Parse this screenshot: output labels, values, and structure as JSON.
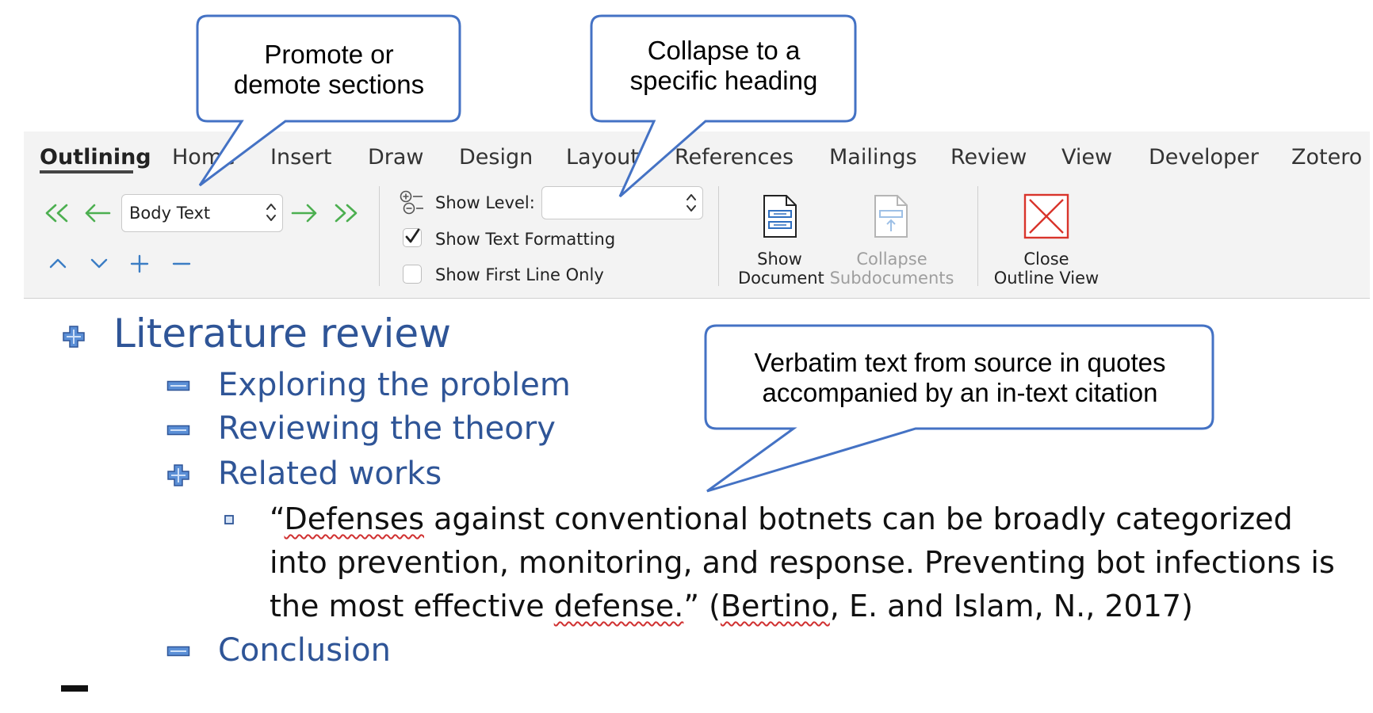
{
  "tabs": [
    "Outlining",
    "Home",
    "Insert",
    "Draw",
    "Design",
    "Layout",
    "References",
    "Mailings",
    "Review",
    "View",
    "Developer",
    "Zotero"
  ],
  "outline_tools": {
    "level_select": "Body Text",
    "show_level_label": "Show Level:",
    "show_level_value": "",
    "show_text_formatting": "Show Text Formatting",
    "show_first_line_only": "Show First Line Only",
    "show_document": [
      "Show",
      "Document"
    ],
    "collapse_subdocuments": [
      "Collapse",
      "Subdocuments"
    ],
    "close_outline_view": [
      "Close",
      "Outline View"
    ]
  },
  "callouts": {
    "promote": [
      "Promote or",
      "demote sections"
    ],
    "collapse": [
      "Collapse to a",
      "specific heading"
    ],
    "verbatim": [
      "Verbatim text from source in quotes",
      "accompanied by an in-text citation"
    ]
  },
  "outline": {
    "heading1": "Literature review",
    "headings2": [
      "Exploring the problem",
      "Reviewing the theory",
      "Related works"
    ],
    "conclusion": "Conclusion",
    "quote_lines": {
      "l1_open": "“",
      "l1_sq": "Defenses",
      "l1_rest": " against conventional botnets can be broadly categorized",
      "l2": "into prevention, monitoring, and response. Preventing bot infections is",
      "l3_a": "the most effective ",
      "l3_sq": "defense.",
      "l3_b": "” (",
      "l3_sq2": "Bertino",
      "l3_c": ", E. and Islam, N., 2017)"
    }
  },
  "colors": {
    "heading": "#2f5597",
    "callout_border": "#4472c4",
    "green_arrow": "#4caf50",
    "blue_control": "#3b7dc4",
    "close_icon": "#d9342b"
  }
}
